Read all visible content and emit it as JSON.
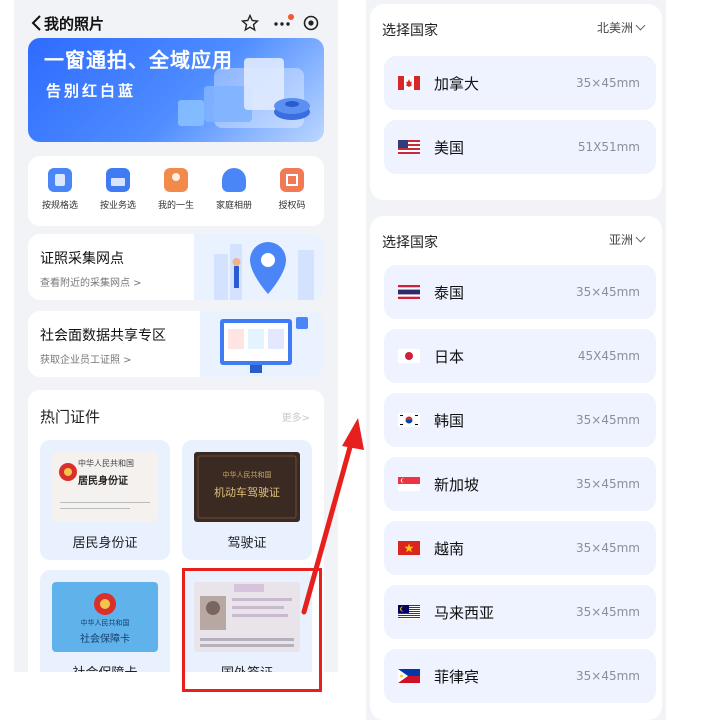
{
  "left": {
    "title": "我的照片",
    "banner": {
      "line1": "一窗通拍、全域应用",
      "line2": "告别红白蓝"
    },
    "quick_actions": [
      {
        "label": "按规格选",
        "icon": "id-photo-icon",
        "color": "#4a86f7"
      },
      {
        "label": "按业务选",
        "icon": "print-icon",
        "color": "#3f7bf2"
      },
      {
        "label": "我的一生",
        "icon": "person-icon",
        "color": "#f28a4c"
      },
      {
        "label": "家庭相册",
        "icon": "home-album-icon",
        "color": "#4a86f7"
      },
      {
        "label": "授权码",
        "icon": "qr-code-icon",
        "color": "#ef7a55"
      }
    ],
    "entries": [
      {
        "title": "证照采集网点",
        "subtitle": "查看附近的采集网点 >"
      },
      {
        "title": "社会面数据共享专区",
        "subtitle": "获取企业员工证照 >"
      }
    ],
    "hot": {
      "title": "热门证件",
      "more": "更多>",
      "docs": [
        {
          "label": "居民身份证",
          "card_text1": "中华人民共和国",
          "card_text2": "居民身份证"
        },
        {
          "label": "驾驶证",
          "card_text1": "中华人民共和国",
          "card_text2": "机动车驾驶证"
        },
        {
          "label": "社会保障卡",
          "card_text1": "中华人民共和国",
          "card_text2": "社会保障卡"
        },
        {
          "label": "国外签证"
        }
      ]
    }
  },
  "right": {
    "regions": [
      {
        "header": "选择国家",
        "value": "北美洲",
        "countries": [
          {
            "name": "加拿大",
            "size": "35×45mm",
            "flag": "canada-flag-icon"
          },
          {
            "name": "美国",
            "size": "51X51mm",
            "flag": "usa-flag-icon"
          }
        ]
      },
      {
        "header": "选择国家",
        "value": "亚洲",
        "countries": [
          {
            "name": "泰国",
            "size": "35×45mm",
            "flag": "thailand-flag-icon"
          },
          {
            "name": "日本",
            "size": "45X45mm",
            "flag": "japan-flag-icon"
          },
          {
            "name": "韩国",
            "size": "35×45mm",
            "flag": "korea-flag-icon"
          },
          {
            "name": "新加坡",
            "size": "35×45mm",
            "flag": "singapore-flag-icon"
          },
          {
            "name": "越南",
            "size": "35×45mm",
            "flag": "vietnam-flag-icon"
          },
          {
            "name": "马来西亚",
            "size": "35×45mm",
            "flag": "malaysia-flag-icon"
          },
          {
            "name": "菲律宾",
            "size": "35×45mm",
            "flag": "philippines-flag-icon"
          }
        ]
      }
    ]
  },
  "colors": {
    "accent": "#2e6bff",
    "highlight": "#e8201d",
    "row_bg": "#eef3ff",
    "page_bg": "#f2f3f7"
  }
}
